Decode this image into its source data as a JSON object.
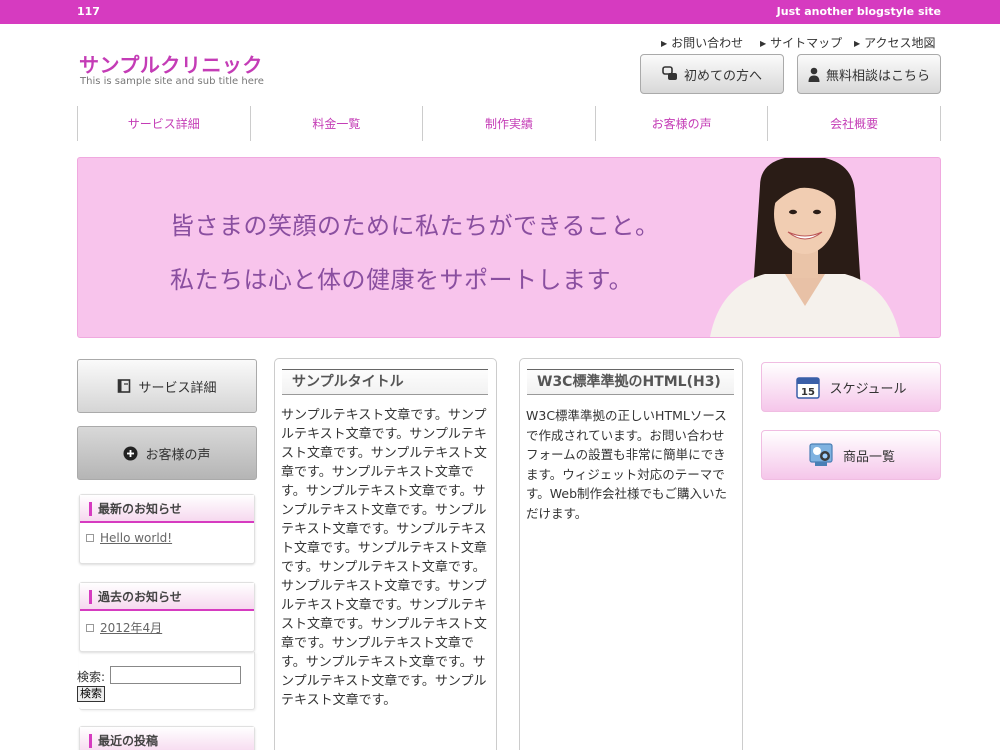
{
  "topbar": {
    "left_text": "117",
    "right_text": "Just another blogstyle site"
  },
  "logo": {
    "title": "サンプルクリニック",
    "subtitle": "This is sample site and sub title here"
  },
  "toplinks": [
    "お問い合わせ",
    "サイトマップ",
    "アクセス地図"
  ],
  "header_buttons": {
    "first_time": "初めての方へ",
    "consult": "無料相談はこちら"
  },
  "nav": [
    "サービス詳細",
    "料金一覧",
    "制作実績",
    "お客様の声",
    "会社概要"
  ],
  "hero": {
    "line1": "皆さまの笑顔のために私たちができること。",
    "line2": "私たちは心と体の健康をサポートします。"
  },
  "left_buttons": {
    "service": "サービス詳細",
    "voice": "お客様の声"
  },
  "widgets": {
    "latest": {
      "title": "最新のお知らせ",
      "item": "Hello world!"
    },
    "archive": {
      "title": "過去のお知らせ",
      "item": "2012年4月"
    },
    "recent": {
      "title": "最近の投稿"
    }
  },
  "search": {
    "label": "検索:",
    "button": "検索",
    "value": ""
  },
  "post1": {
    "title": "サンプルタイトル",
    "body": "サンプルテキスト文章です。サンプルテキスト文章です。サンプルテキスト文章です。サンプルテキスト文章です。サンプルテキスト文章です。サンプルテキスト文章です。サンプルテキスト文章です。サンプルテキスト文章です。サンプルテキスト文章です。サンプルテキスト文章です。サンプルテキスト文章です。サンプルテキスト文章です。サンプルテキスト文章です。サンプルテキスト文章です。サンプルテキスト文章です。サンプルテキスト文章です。サンプルテキスト文章です。サンプルテキスト文章です。サンプルテキスト文章です。"
  },
  "post2": {
    "title": "W3C標準準拠のHTML(H3)",
    "body": "W3C標準準拠の正しいHTMLソースで作成されています。お問い合わせフォームの設置も非常に簡単にできます。ウィジェット対応のテーマです。Web制作会社様でもご購入いただけます。"
  },
  "right_buttons": {
    "schedule": "スケジュール",
    "products": "商品一覧"
  },
  "calendar_day": "15",
  "colors": {
    "accent": "#d63bc0",
    "hero_bg": "#f8c4ec",
    "hero_text": "#8a4fa0"
  }
}
